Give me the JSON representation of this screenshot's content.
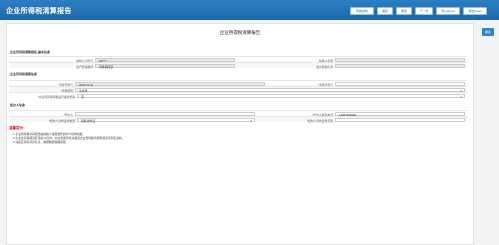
{
  "app": {
    "title": "企业所得税清算报告"
  },
  "toolbar": {
    "buttons": [
      {
        "label": "附报资料"
      },
      {
        "label": "保存"
      },
      {
        "label": "重置"
      },
      {
        "label": "下一步"
      },
      {
        "label": "导入Excel"
      },
      {
        "label": "导出Excel"
      }
    ]
  },
  "side": {
    "label": "报表"
  },
  "page": {
    "title": "企业所得税清算报告"
  },
  "sections": {
    "basic": "企业所得税清算报告-基本信息",
    "liquidation": "企业所得税清算信息",
    "agent": "经办人信息"
  },
  "basic": {
    "taxpayer_id_label": "纳税人识别号",
    "taxpayer_id_value": "91****",
    "taxpayer_name_label": "纳税人名称",
    "period_label": "生产经营期间",
    "period_value": "清算期间至",
    "accountant_label": "会计机构人员",
    "accountant_value": ""
  },
  "liquidation": {
    "start_label": "*清算开始日",
    "start_value": "2020-01-01",
    "end_label": "*清算结束日",
    "end_value": "",
    "reason_label": "*清算原因",
    "reason_value": "请选择",
    "handler_label": "*企业清算所得税是否事务所等",
    "handler_value": "否"
  },
  "agent": {
    "name_label": "*经办人",
    "name_value": "",
    "phone_label": "*经办人联系电话",
    "phone_value": "13957483606",
    "doc_type_label": "*经办人身份证件类型",
    "doc_type_value": "居民身份证",
    "doc_no_label": "*经办人身份证件号码",
    "doc_no_value": ""
  },
  "tips": {
    "title": "温馨提示：",
    "items": [
      "1.企业所得税清算报告由纳税人或其委托的中介机构填报。",
      "2.企业在清算期间结束后15日内，向主管税务机关报送企业所得税清算申报表及附表资料。",
      "3.请如实填写清算信息，确保数据准确完整。"
    ]
  }
}
